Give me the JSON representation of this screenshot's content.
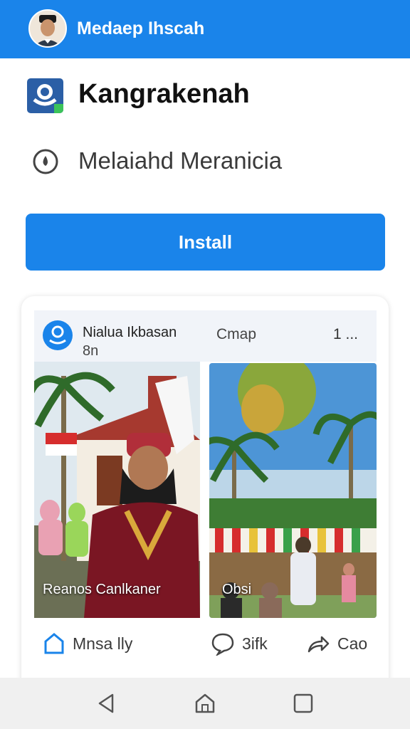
{
  "topbar": {
    "title": "Medaep Ihscah",
    "avatar_icon": "profile-photo",
    "color": "#1a84ea"
  },
  "app": {
    "name": "Kangrakenah",
    "developer": "Melaiahd Meranicia",
    "install_label": "Install"
  },
  "post": {
    "author": "Nialua Ikbasan",
    "time": "8n",
    "tag": "Cmap",
    "count": "1 ...",
    "photos": [
      {
        "caption": "Reanos Canlkaner"
      },
      {
        "caption": "Obsi"
      }
    ],
    "actions": {
      "like": "Mnsa lly",
      "comment": "3ifk",
      "share": "Cao"
    }
  },
  "navbar": {
    "icons": [
      "back-icon",
      "home-icon",
      "recents-icon"
    ]
  }
}
